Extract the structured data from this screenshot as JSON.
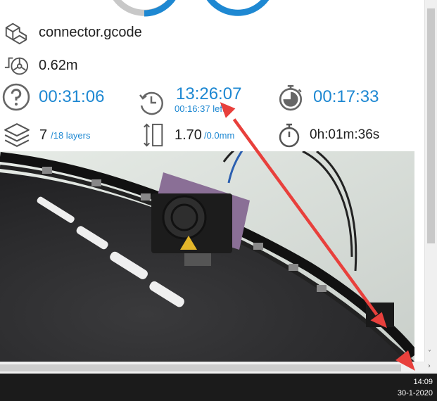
{
  "colors": {
    "accent": "#1e88d2",
    "annotation_arrow": "#e8403c",
    "taskbar": "#1b1b1b"
  },
  "job": {
    "file_icon": "cube-icon",
    "filename": "connector.gcode",
    "filament_icon": "filament-spool-icon",
    "filament_used": "0.62m"
  },
  "times": {
    "elapsed_icon": "question-circle-icon",
    "elapsed": "00:31:06",
    "eta_icon": "clock-history-icon",
    "eta_clock": "13:26:07",
    "eta_left": "00:16:37 left",
    "remaining_icon": "stopwatch-pie-icon",
    "remaining": "00:17:33"
  },
  "layers": {
    "icon": "layers-stack-icon",
    "current": "7",
    "total": "/18 layers",
    "height_icon": "layer-height-icon",
    "height": "1.70",
    "height_unit": "/0.0mm",
    "layer_time_icon": "timer-icon",
    "layer_time": "0h:01m:36s"
  },
  "progress_gauges": {
    "visible_partial": true
  },
  "webcam": {
    "description_icon": "webcam-feed"
  },
  "taskbar": {
    "time": "14:09",
    "date": "30-1-2020"
  }
}
